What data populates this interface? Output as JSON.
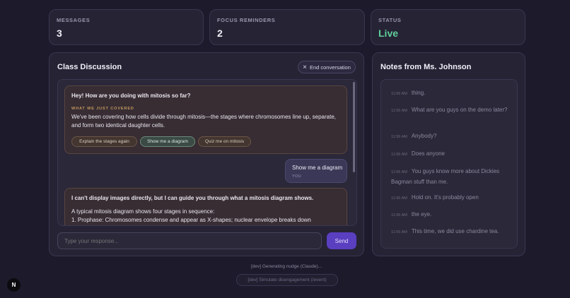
{
  "stats": [
    {
      "label": "MESSAGES",
      "value": "3"
    },
    {
      "label": "FOCUS REMINDERS",
      "value": "2"
    },
    {
      "label": "STATUS",
      "value": "Live"
    }
  ],
  "discussion": {
    "title": "Class Discussion",
    "end_button": "End conversation",
    "close_icon": "×",
    "bot1": {
      "question": "Hey! How are you doing with mitosis so far?",
      "covered_label": "WHAT WE JUST COVERED",
      "covered_line1": "We've been covering how cells divide through mitosis—the stages where chromosomes line up, separate,",
      "covered_line2": "and form two identical daughter cells.",
      "chips": [
        "Explain the stages again",
        "Show me a diagram",
        "Quiz me on mitosis"
      ]
    },
    "user": {
      "text": "Show me a diagram",
      "meta": "YOU"
    },
    "bot2": {
      "line1": "I can't display images directly, but I can guide you through what a mitosis diagram shows.",
      "line2": "A typical mitosis diagram shows four stages in sequence:",
      "line3": "1. Prophase: Chromosomes condense and appear as X-shapes; nuclear envelope breaks down"
    },
    "input_placeholder": "Type your response...",
    "send_label": "Send"
  },
  "notes": {
    "title": "Notes from Ms. Johnson",
    "items": [
      {
        "time": "11:56 AM",
        "text": "thing."
      },
      {
        "time": "11:56 AM",
        "text": "What are you guys on the demo later?"
      },
      {
        "time": "11:56 AM",
        "text": "Anybody?"
      },
      {
        "time": "11:56 AM",
        "text": "Does anyone"
      },
      {
        "time": "11:56 AM",
        "text": "You guys know more about Dickies Bagman stuff than me."
      },
      {
        "time": "11:56 AM",
        "text": "Hold on. It's probably open"
      },
      {
        "time": "11:56 AM",
        "text": "the eye."
      },
      {
        "time": "11:56 AM",
        "text": "This time, we did use chardine tea."
      }
    ]
  },
  "dev": {
    "status": "[dev] Generating nudge (Claude)...",
    "simulate_button": "[dev] Simulate disengagement (/event)"
  },
  "logo": "N"
}
